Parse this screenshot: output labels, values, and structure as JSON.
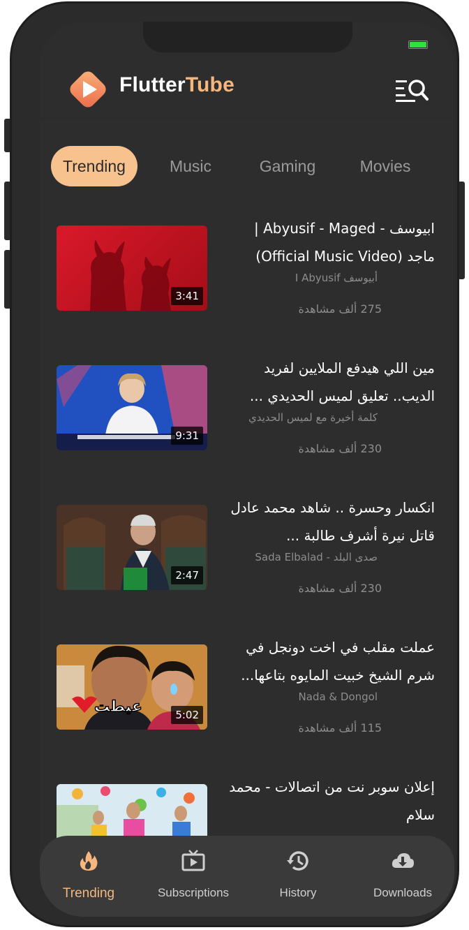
{
  "app": {
    "title_part1": "Flutter",
    "title_part2": "Tube",
    "accent_color": "#f6b77e",
    "background_color": "#2d2d2d"
  },
  "status_bar": {
    "battery_icon": "battery-full-icon"
  },
  "header": {
    "search_icon": "search-list-icon"
  },
  "chips": [
    {
      "label": "Trending",
      "active": true
    },
    {
      "label": "Music",
      "active": false
    },
    {
      "label": "Gaming",
      "active": false
    },
    {
      "label": "Movies",
      "active": false
    }
  ],
  "videos": [
    {
      "title": "ابيوسف - Abyusif - Maged | ماجد (Official Music Video)",
      "channel": "أبيوسف I Abyusif",
      "views": "275 ألف مشاهدة",
      "duration": "3:41"
    },
    {
      "title": "مين اللي هيدفع الملايين لفريد الديب.. تعليق لميس الحديدي ...",
      "channel": "كلمة أخيرة مع لميس الحديدي",
      "views": "230 ألف مشاهدة",
      "duration": "9:31"
    },
    {
      "title": "انكسار وحسرة .. شاهد محمد عادل قاتل نيرة أشرف طالبة ...",
      "channel": "صدى البلد - Sada Elbalad",
      "views": "230 ألف مشاهدة",
      "duration": "2:47"
    },
    {
      "title": "عملت مقلب في اخت دونجل في شرم الشيخ خبيت المايوه بتاعها...",
      "channel": "Nada & Dongol",
      "views": "115 ألف مشاهدة",
      "duration": "5:02",
      "thumb_overlay_text": "عيطت"
    },
    {
      "title": "إعلان سوبر نت من اتصالات - محمد سلام",
      "channel": "",
      "views": "",
      "duration": ""
    }
  ],
  "bottom_nav": [
    {
      "label": "Trending",
      "icon": "fire-icon",
      "active": true
    },
    {
      "label": "Subscriptions",
      "icon": "subscriptions-tv-icon",
      "active": false
    },
    {
      "label": "History",
      "icon": "history-icon",
      "active": false
    },
    {
      "label": "Downloads",
      "icon": "cloud-download-icon",
      "active": false
    }
  ]
}
